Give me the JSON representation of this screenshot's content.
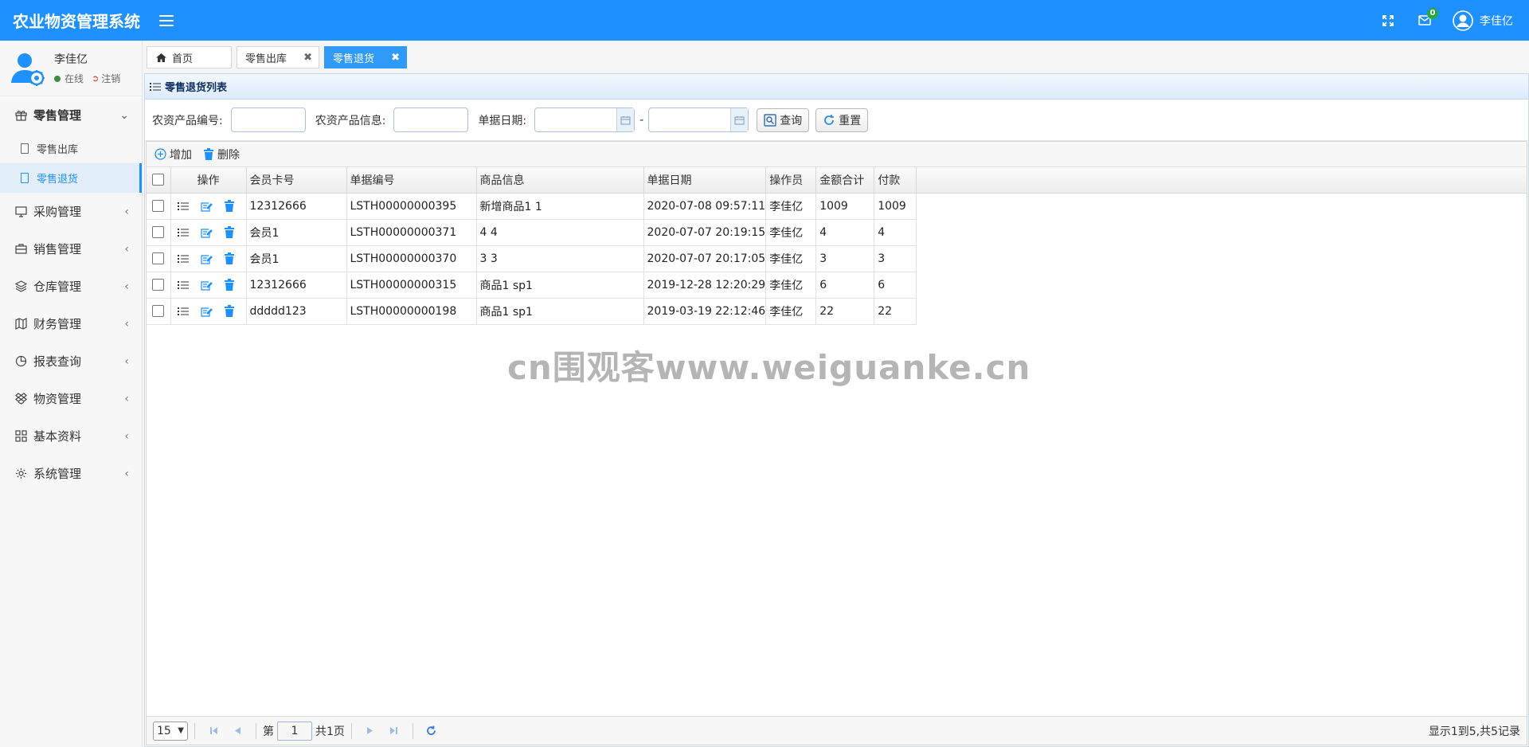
{
  "header": {
    "title": "农业物资管理系统",
    "badge_count": "0",
    "username": "李佳亿"
  },
  "sidebar": {
    "user": {
      "name": "李佳亿",
      "status": "在线",
      "logout": "注销"
    },
    "menu": [
      {
        "label": "零售管理",
        "icon": "gift-icon",
        "open": true,
        "children": [
          {
            "label": "零售出库",
            "active": false
          },
          {
            "label": "零售退货",
            "active": true
          }
        ]
      },
      {
        "label": "采购管理",
        "icon": "monitor-icon"
      },
      {
        "label": "销售管理",
        "icon": "briefcase-icon"
      },
      {
        "label": "仓库管理",
        "icon": "layers-icon"
      },
      {
        "label": "财务管理",
        "icon": "map-icon"
      },
      {
        "label": "报表查询",
        "icon": "pie-chart-icon"
      },
      {
        "label": "物资管理",
        "icon": "dropbox-icon"
      },
      {
        "label": "基本资料",
        "icon": "grid-icon"
      },
      {
        "label": "系统管理",
        "icon": "gear-icon"
      }
    ]
  },
  "tabs": [
    {
      "label": "首页",
      "closable": false,
      "active": false
    },
    {
      "label": "零售出库",
      "closable": true,
      "active": false
    },
    {
      "label": "零售退货",
      "closable": true,
      "active": true
    }
  ],
  "panel": {
    "title": "零售退货列表",
    "filter": {
      "code_label": "农资产品编号:",
      "info_label": "农资产品信息:",
      "date_label": "单据日期:",
      "date_sep": "-",
      "query_button": "查询",
      "reset_button": "重置"
    },
    "toolbar": {
      "add": "增加",
      "delete": "删除"
    },
    "columns": [
      "操作",
      "会员卡号",
      "单据编号",
      "商品信息",
      "单据日期",
      "操作员",
      "金额合计",
      "付款"
    ],
    "rows": [
      [
        "12312666",
        "LSTH00000000395",
        "新增商品1 1",
        "2020-07-08 09:57:11",
        "李佳亿",
        "1009",
        "1009"
      ],
      [
        "会员1",
        "LSTH00000000371",
        "4 4",
        "2020-07-07 20:19:15",
        "李佳亿",
        "4",
        "4"
      ],
      [
        "会员1",
        "LSTH00000000370",
        "3 3",
        "2020-07-07 20:17:05",
        "李佳亿",
        "3",
        "3"
      ],
      [
        "12312666",
        "LSTH00000000315",
        "商品1 sp1",
        "2019-12-28 12:20:29",
        "李佳亿",
        "6",
        "6"
      ],
      [
        "ddddd123",
        "LSTH00000000198",
        "商品1 sp1",
        "2019-03-19 22:12:46",
        "李佳亿",
        "22",
        "22"
      ]
    ],
    "pager": {
      "page_size": "15",
      "page_prefix": "第",
      "page_value": "1",
      "page_total": "共1页",
      "summary": "显示1到5,共5记录"
    }
  },
  "watermark": "cn围观客www.weiguanke.cn",
  "colors": {
    "primary": "#1e90ff",
    "tab_active": "#2f9af8",
    "icon_blue": "#1e90ff"
  }
}
